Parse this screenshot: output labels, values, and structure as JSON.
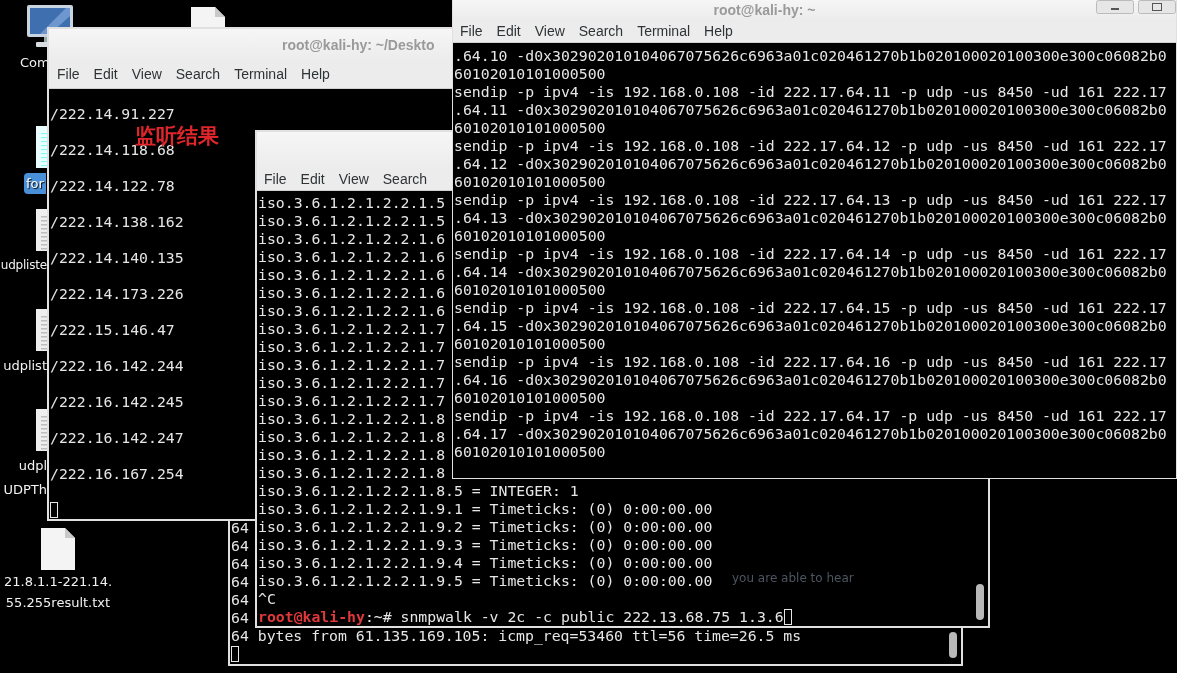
{
  "desktop": {
    "icons": [
      {
        "kind": "computer",
        "label_lines": [
          "Com"
        ],
        "selected": false
      },
      {
        "kind": "file",
        "selected": false
      },
      {
        "kind": "textfile",
        "label_lines": [
          "for"
        ],
        "selected": true
      },
      {
        "kind": "textfile",
        "label_lines": [
          "udpliste"
        ],
        "selected": false
      },
      {
        "kind": "textfile",
        "label_lines": [
          "udplist"
        ],
        "selected": false
      },
      {
        "kind": "textfile",
        "label_lines": [
          "udpl",
          "UDPTh"
        ],
        "selected": false
      },
      {
        "kind": "file",
        "label_lines": [
          "21.8.1.1-221.14.",
          "55.255result.txt"
        ],
        "selected": false
      }
    ],
    "tagline": "you are able to hear"
  },
  "annotation": "监听结果",
  "windows": [
    {
      "scrollbar": true,
      "lines": [
        {
          "kind": "text",
          "text": "64"
        },
        {
          "kind": "text",
          "text": "64"
        },
        {
          "kind": "text",
          "text": "64"
        },
        {
          "kind": "text",
          "text": "64"
        },
        {
          "kind": "text",
          "text": "64"
        },
        {
          "kind": "text",
          "text": "64"
        },
        {
          "kind": "text",
          "text": "64 bytes from 61.135.169.105: icmp_req=53460 ttl=56 time=26.5 ms"
        },
        {
          "kind": "cursor"
        }
      ]
    },
    {
      "title": "root@kali-hy: ~/Deskto",
      "menu": [
        "File",
        "Edit",
        "View",
        "Search",
        "Terminal",
        "Help"
      ],
      "lines": [
        {
          "kind": "text",
          "text": "/222.14.91.227"
        },
        {
          "kind": "text",
          "text": "/222.14.118.68"
        },
        {
          "kind": "text",
          "text": "/222.14.122.78"
        },
        {
          "kind": "text",
          "text": "/222.14.138.162"
        },
        {
          "kind": "text",
          "text": "/222.14.140.135"
        },
        {
          "kind": "text",
          "text": "/222.14.173.226"
        },
        {
          "kind": "text",
          "text": "/222.15.146.47"
        },
        {
          "kind": "text",
          "text": "/222.16.142.244"
        },
        {
          "kind": "text",
          "text": "/222.16.142.245"
        },
        {
          "kind": "text",
          "text": "/222.16.142.247"
        },
        {
          "kind": "text",
          "text": "/222.16.167.254"
        },
        {
          "kind": "cursor"
        }
      ]
    },
    {
      "menu": [
        "File",
        "Edit",
        "View",
        "Search"
      ],
      "scrollbar": true,
      "lines": [
        {
          "kind": "text",
          "text": "iso.3.6.1.2.1.2.2.1.5"
        },
        {
          "kind": "text",
          "text": "iso.3.6.1.2.1.2.2.1.5"
        },
        {
          "kind": "text",
          "text": "iso.3.6.1.2.1.2.2.1.6"
        },
        {
          "kind": "text",
          "text": "iso.3.6.1.2.1.2.2.1.6"
        },
        {
          "kind": "text",
          "text": "iso.3.6.1.2.1.2.2.1.6"
        },
        {
          "kind": "text",
          "text": "iso.3.6.1.2.1.2.2.1.6"
        },
        {
          "kind": "text",
          "text": "iso.3.6.1.2.1.2.2.1.6"
        },
        {
          "kind": "text",
          "text": "iso.3.6.1.2.1.2.2.1.7"
        },
        {
          "kind": "text",
          "text": "iso.3.6.1.2.1.2.2.1.7"
        },
        {
          "kind": "text",
          "text": "iso.3.6.1.2.1.2.2.1.7"
        },
        {
          "kind": "text",
          "text": "iso.3.6.1.2.1.2.2.1.7"
        },
        {
          "kind": "text",
          "text": "iso.3.6.1.2.1.2.2.1.7"
        },
        {
          "kind": "text",
          "text": "iso.3.6.1.2.1.2.2.1.8"
        },
        {
          "kind": "text",
          "text": "iso.3.6.1.2.1.2.2.1.8"
        },
        {
          "kind": "text",
          "text": "iso.3.6.1.2.1.2.2.1.8"
        },
        {
          "kind": "text",
          "text": "iso.3.6.1.2.1.2.2.1.8"
        },
        {
          "kind": "text",
          "text": "iso.3.6.1.2.1.2.2.1.8.5 = INTEGER: 1"
        },
        {
          "kind": "text",
          "text": "iso.3.6.1.2.1.2.2.1.9.1 = Timeticks: (0) 0:00:00.00"
        },
        {
          "kind": "text",
          "text": "iso.3.6.1.2.1.2.2.1.9.2 = Timeticks: (0) 0:00:00.00"
        },
        {
          "kind": "text",
          "text": "iso.3.6.1.2.1.2.2.1.9.3 = Timeticks: (0) 0:00:00.00"
        },
        {
          "kind": "text",
          "text": "iso.3.6.1.2.1.2.2.1.9.4 = Timeticks: (0) 0:00:00.00"
        },
        {
          "kind": "text",
          "text": "iso.3.6.1.2.1.2.2.1.9.5 = Timeticks: (0) 0:00:00.00"
        },
        {
          "kind": "text",
          "text": "^C"
        },
        {
          "kind": "prompt",
          "user": "root@kali-hy",
          "text": ":~# snmpwalk -v 2c -c public 222.13.68.75 1.3.6",
          "cursor": true
        }
      ]
    },
    {
      "title": "root@kali-hy: ~",
      "window_buttons": true,
      "menu": [
        "File",
        "Edit",
        "View",
        "Search",
        "Terminal",
        "Help"
      ],
      "lines": [
        {
          "kind": "text",
          "text": ".64.10 -d0x302902010104067075626c6963a01c020461270b1b020100020100300e300c06082b0"
        },
        {
          "kind": "text",
          "text": "60102010101000500"
        },
        {
          "kind": "text",
          "text": "sendip -p ipv4 -is 192.168.0.108 -id 222.17.64.11 -p udp -us 8450 -ud 161 222.17"
        },
        {
          "kind": "text",
          "text": ".64.11 -d0x302902010104067075626c6963a01c020461270b1b020100020100300e300c06082b0"
        },
        {
          "kind": "text",
          "text": "60102010101000500"
        },
        {
          "kind": "text",
          "text": "sendip -p ipv4 -is 192.168.0.108 -id 222.17.64.12 -p udp -us 8450 -ud 161 222.17"
        },
        {
          "kind": "text",
          "text": ".64.12 -d0x302902010104067075626c6963a01c020461270b1b020100020100300e300c06082b0"
        },
        {
          "kind": "text",
          "text": "60102010101000500"
        },
        {
          "kind": "text",
          "text": "sendip -p ipv4 -is 192.168.0.108 -id 222.17.64.13 -p udp -us 8450 -ud 161 222.17"
        },
        {
          "kind": "text",
          "text": ".64.13 -d0x302902010104067075626c6963a01c020461270b1b020100020100300e300c06082b0"
        },
        {
          "kind": "text",
          "text": "60102010101000500"
        },
        {
          "kind": "text",
          "text": "sendip -p ipv4 -is 192.168.0.108 -id 222.17.64.14 -p udp -us 8450 -ud 161 222.17"
        },
        {
          "kind": "text",
          "text": ".64.14 -d0x302902010104067075626c6963a01c020461270b1b020100020100300e300c06082b0"
        },
        {
          "kind": "text",
          "text": "60102010101000500"
        },
        {
          "kind": "text",
          "text": "sendip -p ipv4 -is 192.168.0.108 -id 222.17.64.15 -p udp -us 8450 -ud 161 222.17"
        },
        {
          "kind": "text",
          "text": ".64.15 -d0x302902010104067075626c6963a01c020461270b1b020100020100300e300c06082b0"
        },
        {
          "kind": "text",
          "text": "60102010101000500"
        },
        {
          "kind": "text",
          "text": "sendip -p ipv4 -is 192.168.0.108 -id 222.17.64.16 -p udp -us 8450 -ud 161 222.17"
        },
        {
          "kind": "text",
          "text": ".64.16 -d0x302902010104067075626c6963a01c020461270b1b020100020100300e300c06082b0"
        },
        {
          "kind": "text",
          "text": "60102010101000500"
        },
        {
          "kind": "text",
          "text": "sendip -p ipv4 -is 192.168.0.108 -id 222.17.64.17 -p udp -us 8450 -ud 161 222.17"
        },
        {
          "kind": "text",
          "text": ".64.17 -d0x302902010104067075626c6963a01c020461270b1b020100020100300e300c06082b0"
        },
        {
          "kind": "text",
          "text": "60102010101000500"
        }
      ]
    }
  ]
}
